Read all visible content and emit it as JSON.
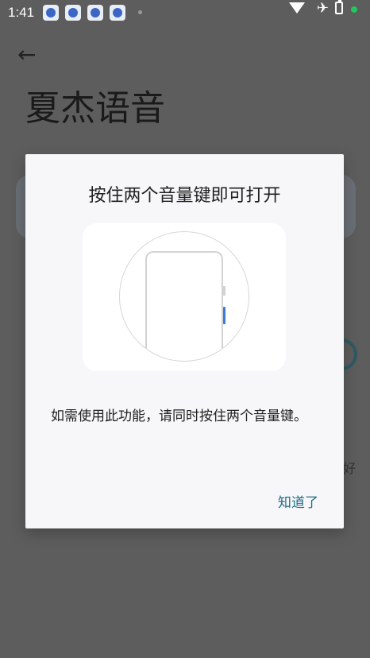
{
  "status_bar": {
    "time": "1:41",
    "notification_icons": [
      "baidu-app-icon",
      "baidu-app-icon",
      "baidu-app-icon",
      "baidu-app-icon"
    ],
    "right_icons": [
      "wifi-icon",
      "airplane-mode-icon",
      "battery-charging-icon",
      "privacy-indicator-dot"
    ]
  },
  "background_app": {
    "back_icon": "arrow-left-icon",
    "title": "夏杰语音",
    "partial_text": "好"
  },
  "dialog": {
    "title": "按住两个音量键即可打开",
    "illustration": "phone-volume-keys-illustration",
    "body": "如需使用此功能，请同时按住两个音量键。",
    "confirm_button": "知道了"
  },
  "colors": {
    "scrim": "#5d5d5d",
    "dialog_bg": "#f7f7fa",
    "accent_button": "#1f6b84",
    "volume_highlight": "#3a7bdc",
    "privacy_dot": "#22c55e"
  }
}
